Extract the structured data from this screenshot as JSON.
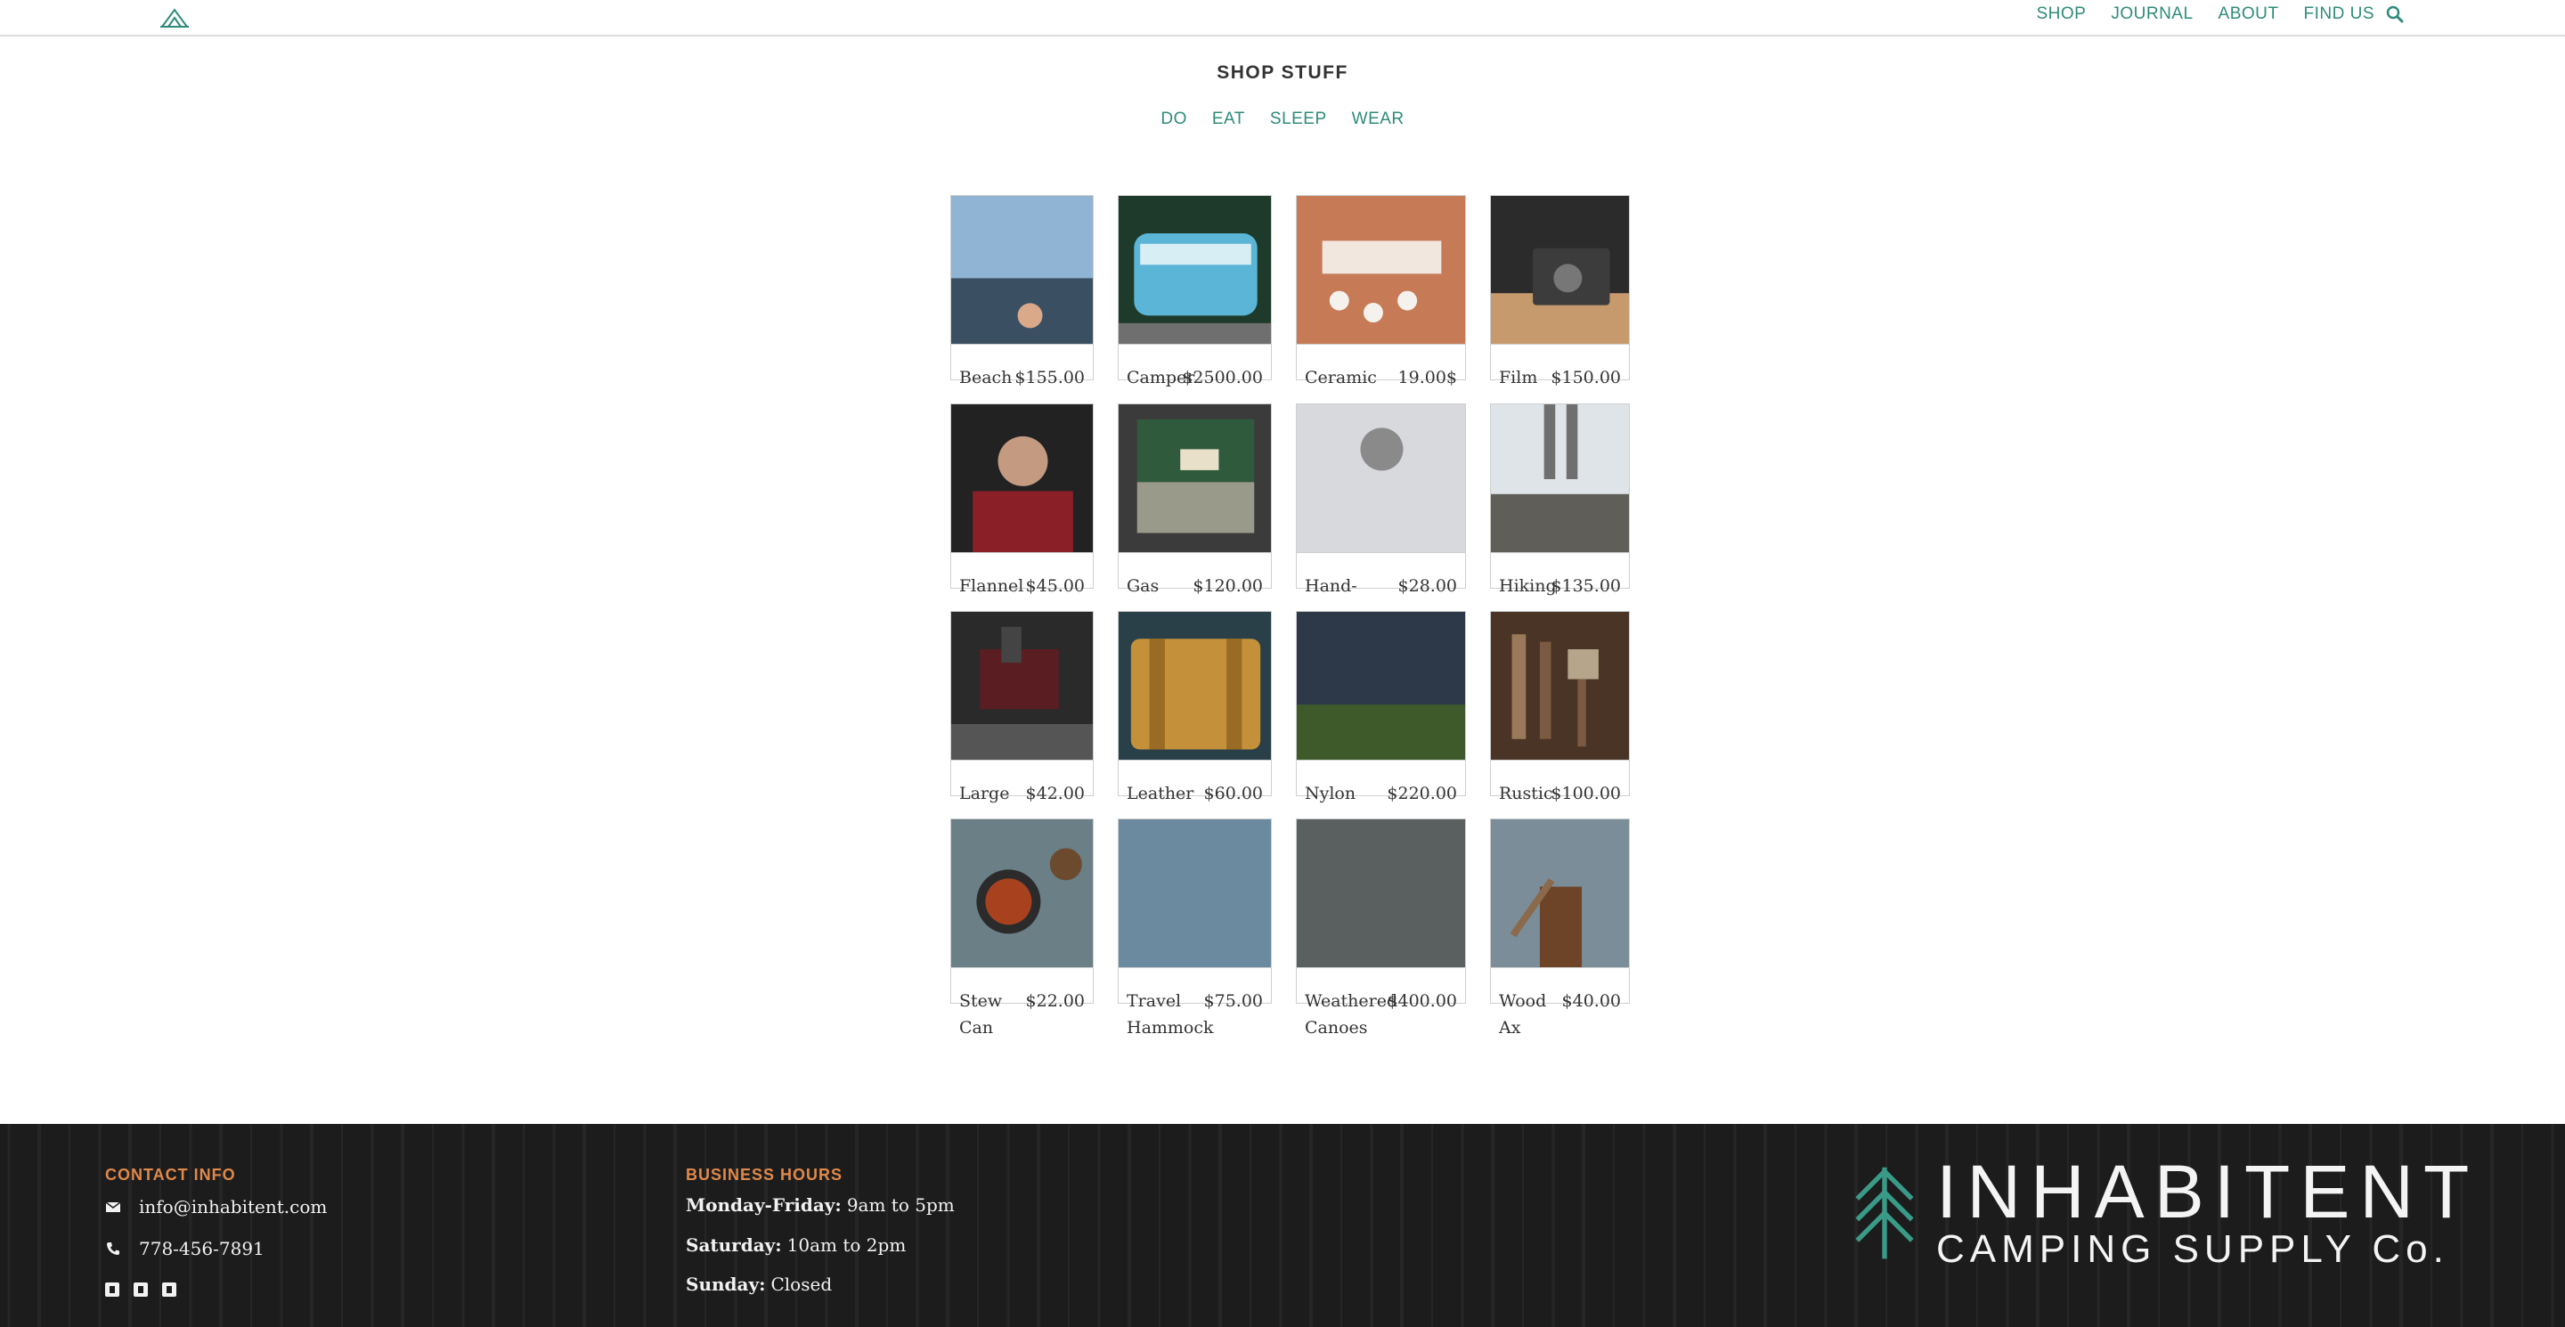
{
  "nav": {
    "items": [
      "SHOP",
      "JOURNAL",
      "ABOUT",
      "FIND US"
    ]
  },
  "page": {
    "title": "SHOP STUFF",
    "categories": [
      "DO",
      "EAT",
      "SLEEP",
      "WEAR"
    ]
  },
  "products": [
    {
      "name": "Beach Tent",
      "price": "$155.00"
    },
    {
      "name": "Camper Van",
      "price": "$2500.00"
    },
    {
      "name": "Ceramic Mugs",
      "price": "19.00$"
    },
    {
      "name": "Film Camera",
      "price": "$150.00"
    },
    {
      "name": "Flannel Shirt",
      "price": "$45.00"
    },
    {
      "name": "Gas Stove",
      "price": "$120.00"
    },
    {
      "name": "Hand-Knit Toque",
      "price": "$28.00"
    },
    {
      "name": "Hiking Boots",
      "price": "$135.00"
    },
    {
      "name": "Large Thermos",
      "price": "$42.00"
    },
    {
      "name": "Leather Satchel",
      "price": "$60.00"
    },
    {
      "name": "Nylon Tent",
      "price": "$220.00"
    },
    {
      "name": "Rustic Tools",
      "price": "$100.00"
    },
    {
      "name": "Stew Can",
      "price": "$22.00"
    },
    {
      "name": "Travel Hammock",
      "price": "$75.00"
    },
    {
      "name": "Weathered Canoes",
      "price": "$400.00"
    },
    {
      "name": "Wood Ax",
      "price": "$40.00"
    }
  ],
  "footer": {
    "contact_heading": "CONTACT INFO",
    "email": "info@inhabitent.com",
    "phone": "778-456-7891",
    "hours_heading": "BUSINESS HOURS",
    "hours": [
      {
        "day": "Monday-Friday:",
        "time": "9am to 5pm"
      },
      {
        "day": "Saturday:",
        "time": "10am to 2pm"
      },
      {
        "day": "Sunday:",
        "time": "Closed"
      }
    ],
    "brand_line1": "INHABITENT",
    "brand_line2": "CAMPING SUPPLY Co."
  },
  "colors": {
    "accent": "#2e8b7a",
    "footer_heading": "#e0894a",
    "footer_bg": "#1d1d1d"
  },
  "icons": [
    "tent-logo-icon",
    "search-icon",
    "envelope-icon",
    "phone-icon",
    "facebook-icon",
    "twitter-icon",
    "google-plus-icon",
    "tree-logo-icon"
  ]
}
